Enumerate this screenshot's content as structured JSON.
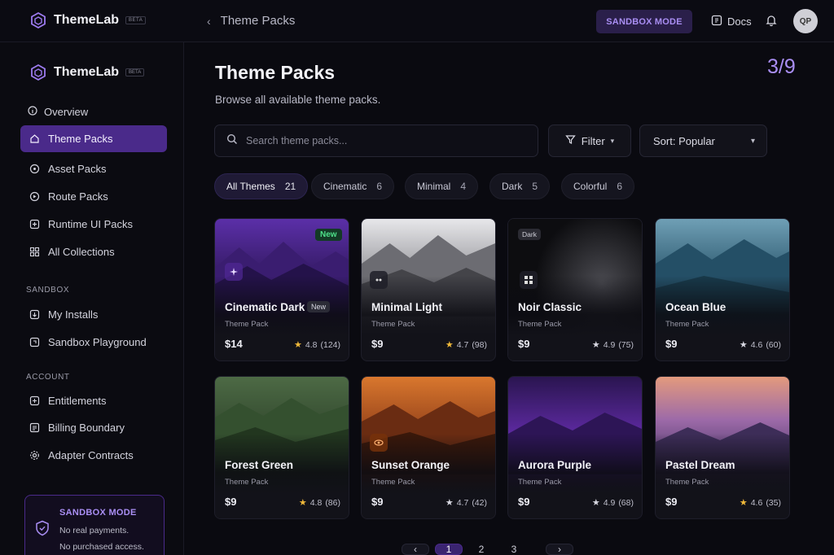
{
  "app": {
    "name": "ThemeLab",
    "beta": "BETA"
  },
  "topbar": {
    "breadcrumb": "Theme Packs",
    "sandbox_pill": "SANDBOX MODE",
    "docs": "Docs",
    "avatar_initials": "QP"
  },
  "sidebar": {
    "overview": "Overview",
    "items": [
      {
        "label": "Theme Packs",
        "icon": "home-icon",
        "active": true
      },
      {
        "label": "Asset Packs",
        "icon": "tag-icon"
      },
      {
        "label": "Route Packs",
        "icon": "route-icon"
      },
      {
        "label": "Runtime UI Packs",
        "icon": "plus-square-icon"
      },
      {
        "label": "All Collections",
        "icon": "grid-icon"
      }
    ],
    "section_sandbox": "SANDBOX",
    "sandbox_items": [
      {
        "label": "My Installs",
        "icon": "download-icon"
      },
      {
        "label": "Sandbox Playground",
        "icon": "playground-icon"
      }
    ],
    "section_account": "ACCOUNT",
    "account_items": [
      {
        "label": "Entitlements",
        "icon": "plus-box-icon"
      },
      {
        "label": "Billing Boundary",
        "icon": "document-icon"
      },
      {
        "label": "Adapter Contracts",
        "icon": "gear-icon"
      }
    ],
    "sandbox_card": {
      "title": "SANDBOX MODE",
      "line1": "No real payments.",
      "line2": "No purchased access."
    }
  },
  "main": {
    "title": "Theme Packs",
    "subtitle": "Browse all available theme packs.",
    "counter": "3/9",
    "search_placeholder": "Search theme packs...",
    "filter_label": "Filter",
    "sort_label": "Sort: Popular"
  },
  "chips": [
    {
      "label": "All Themes",
      "count": "21",
      "active": true
    },
    {
      "label": "Cinematic",
      "count": "6"
    },
    {
      "label": "Minimal",
      "count": "4"
    },
    {
      "label": "Dark",
      "count": "5"
    },
    {
      "label": "Colorful",
      "count": "6"
    }
  ],
  "cards": [
    {
      "name": "Cinematic Dark",
      "type": "Theme Pack",
      "price": "$14",
      "rating": "4.8",
      "reviews": "(124)",
      "badge": "New",
      "inline_badge": "New"
    },
    {
      "name": "Minimal Light",
      "type": "Theme Pack",
      "price": "$9",
      "rating": "4.7",
      "reviews": "(98)"
    },
    {
      "name": "Noir Classic",
      "type": "Theme Pack",
      "price": "$9",
      "rating": "4.9",
      "reviews": "(75)",
      "tag": "Dark"
    },
    {
      "name": "Ocean Blue",
      "type": "Theme Pack",
      "price": "$9",
      "rating": "4.6",
      "reviews": "(60)"
    },
    {
      "name": "Forest Green",
      "type": "Theme Pack",
      "price": "$9",
      "rating": "4.8",
      "reviews": "(86)"
    },
    {
      "name": "Sunset Orange",
      "type": "Theme Pack",
      "price": "$9",
      "rating": "4.7",
      "reviews": "(42)"
    },
    {
      "name": "Aurora Purple",
      "type": "Theme Pack",
      "price": "$9",
      "rating": "4.9",
      "reviews": "(68)"
    },
    {
      "name": "Pastel Dream",
      "type": "Theme Pack",
      "price": "$9",
      "rating": "4.6",
      "reviews": "(35)"
    }
  ],
  "pagination": {
    "pages": [
      "1",
      "2",
      "3"
    ],
    "current": "1"
  },
  "colors": {
    "accent": "#a98ef3",
    "active_bg": "#4a2a8a",
    "star": "#f0b93a",
    "new_badge": "#4ee08a"
  }
}
